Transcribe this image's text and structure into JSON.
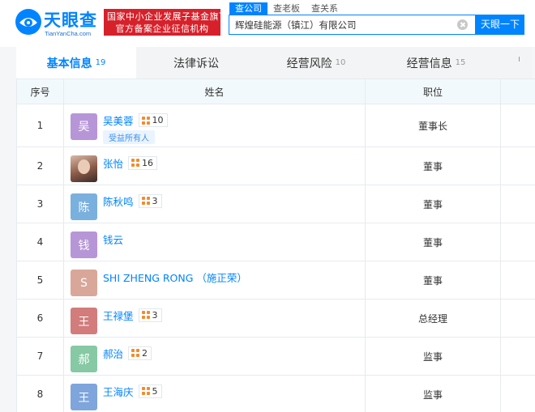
{
  "header": {
    "logo_text": "天眼查",
    "logo_sub": "TianYanCha.com",
    "badge_line1": "国家中小企业发展子基金旗下",
    "badge_line2": "官方备案企业征信机构",
    "search_tabs": [
      "查公司",
      "查老板",
      "查关系"
    ],
    "search_value": "辉煌硅能源（镇江）有限公司",
    "search_button": "天眼一下"
  },
  "tabs": [
    {
      "label": "基本信息",
      "count": "19"
    },
    {
      "label": "法律诉讼",
      "count": ""
    },
    {
      "label": "经营风险",
      "count": "10"
    },
    {
      "label": "经营信息",
      "count": "15"
    }
  ],
  "table": {
    "headers": {
      "index": "序号",
      "name": "姓名",
      "position": "职位"
    },
    "rows": [
      {
        "index": "1",
        "avatar": "吴",
        "name": "吴美蓉",
        "rel": "10",
        "tag": "受益所有人",
        "position": "董事长",
        "color": "#b796d8"
      },
      {
        "index": "2",
        "avatar": "",
        "name": "张怡",
        "rel": "16",
        "tag": "",
        "position": "董事",
        "color": ""
      },
      {
        "index": "3",
        "avatar": "陈",
        "name": "陈秋鸣",
        "rel": "3",
        "tag": "",
        "position": "董事",
        "color": "#7ab0de"
      },
      {
        "index": "4",
        "avatar": "钱",
        "name": "钱云",
        "rel": "",
        "tag": "",
        "position": "董事",
        "color": "#b796d8"
      },
      {
        "index": "5",
        "avatar": "S",
        "name": "SHI ZHENG RONG （施正荣）",
        "rel": "",
        "tag": "",
        "position": "董事",
        "color": "#d9a79a"
      },
      {
        "index": "6",
        "avatar": "王",
        "name": "王禄堡",
        "rel": "3",
        "tag": "",
        "position": "总经理",
        "color": "#d27c7c"
      },
      {
        "index": "7",
        "avatar": "郝",
        "name": "郝治",
        "rel": "2",
        "tag": "",
        "position": "监事",
        "color": "#86c9a4"
      },
      {
        "index": "8",
        "avatar": "王",
        "name": "王海庆",
        "rel": "5",
        "tag": "",
        "position": "监事",
        "color": "#7ea5dc"
      }
    ]
  }
}
